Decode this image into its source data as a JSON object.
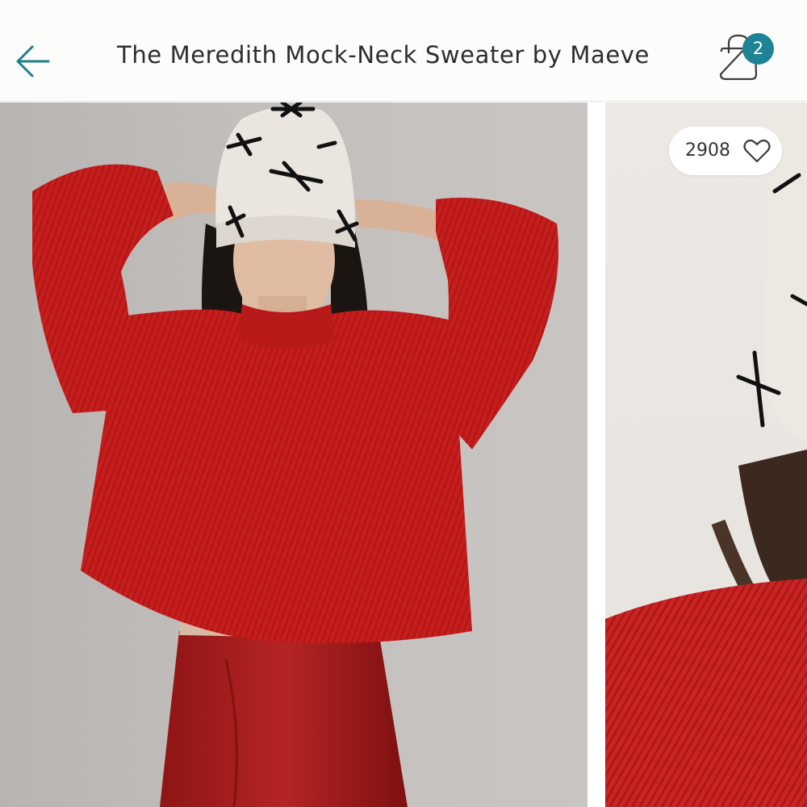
{
  "header": {
    "title": "The Meredith Mock-Neck Sweater by Maeve",
    "cart_count": "2",
    "back_icon": "arrow-left-icon",
    "cart_icon": "shopping-bag-icon"
  },
  "gallery": {
    "images": [
      {
        "description": "Model in red mock-neck sweater, cream beanie with black bows, red leather skirt"
      },
      {
        "description": "Close-up of sweater neckline and beanie"
      }
    ],
    "likes": "2908",
    "like_icon": "heart-outline-icon"
  },
  "colors": {
    "accent": "#1e8394",
    "sweater_red": "#c81e1e",
    "header_bg": "#fcfcfa"
  }
}
